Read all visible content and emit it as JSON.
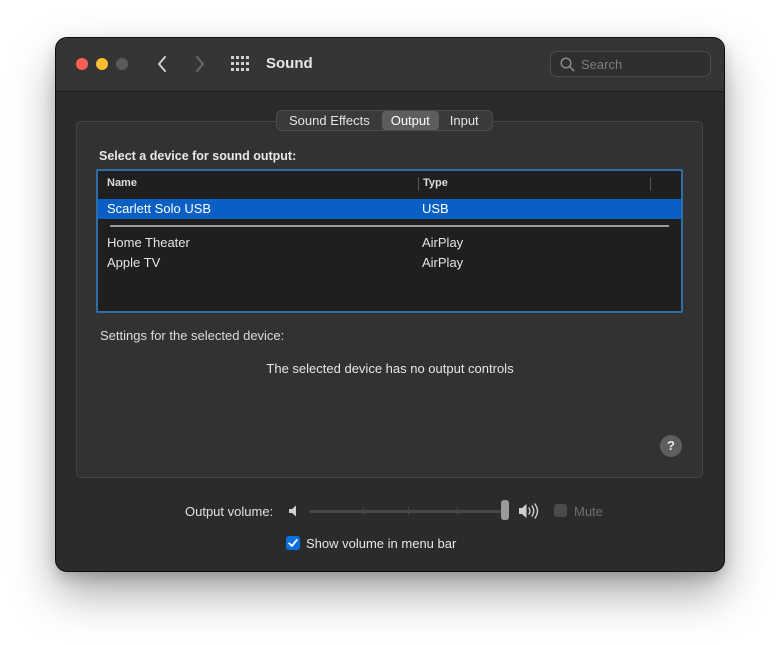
{
  "window": {
    "title": "Sound"
  },
  "search": {
    "placeholder": "Search"
  },
  "tabs": [
    {
      "label": "Sound Effects",
      "selected": false
    },
    {
      "label": "Output",
      "selected": true
    },
    {
      "label": "Input",
      "selected": false
    }
  ],
  "output": {
    "section_label": "Select a device for sound output:",
    "columns": {
      "name": "Name",
      "type": "Type"
    },
    "devices": [
      {
        "name": "Scarlett Solo USB",
        "type": "USB",
        "selected": true
      },
      {
        "name": "Home Theater",
        "type": "AirPlay",
        "selected": false
      },
      {
        "name": "Apple TV",
        "type": "AirPlay",
        "selected": false
      }
    ],
    "settings_label": "Settings for the selected device:",
    "no_controls_message": "The selected device has no output controls"
  },
  "help": {
    "label": "?"
  },
  "volume": {
    "label": "Output volume:",
    "level": 1.0,
    "mute_label": "Mute",
    "muted": false,
    "mute_enabled": false
  },
  "menu_bar": {
    "label": "Show volume in menu bar",
    "checked": true
  },
  "colors": {
    "accent": "#0a72e0",
    "selection": "#0a5fc4",
    "table_focus": "#2b6ea8",
    "close": "#ff5f57",
    "minimize": "#febc2e"
  },
  "icons": {
    "close": "close-button",
    "minimize": "minimize-button",
    "zoom": "zoom-button-disabled",
    "back": "chevron-left-icon",
    "forward": "chevron-right-icon",
    "grid": "grid-icon",
    "search": "search-icon",
    "volume_low": "speaker-low-icon",
    "volume_high": "speaker-high-icon"
  }
}
